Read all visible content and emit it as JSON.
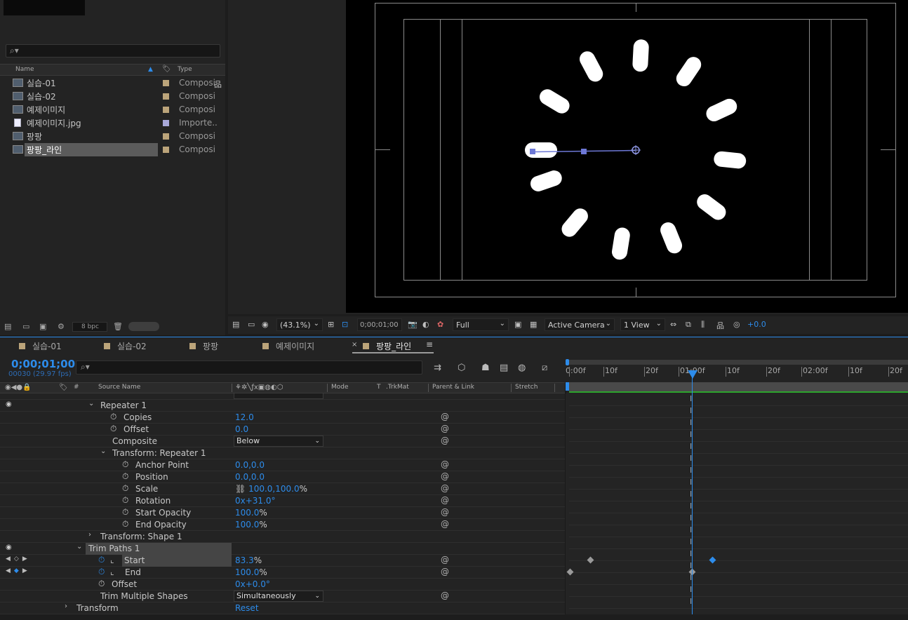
{
  "project": {
    "search_placeholder": "⌕▾",
    "columns": {
      "name": "Name",
      "type": "Type"
    },
    "items": [
      {
        "name": "실습-01",
        "type": "Composi",
        "icon": "composition-icon"
      },
      {
        "name": "실습-02",
        "type": "Composi",
        "icon": "composition-icon"
      },
      {
        "name": "예제이미지",
        "type": "Composi",
        "icon": "composition-icon"
      },
      {
        "name": "예제이미지.jpg",
        "type": "Importe..",
        "icon": "image-file-icon"
      },
      {
        "name": "팡팡",
        "type": "Composi",
        "icon": "composition-icon"
      },
      {
        "name": "팡팡_라인",
        "type": "Composi",
        "icon": "composition-icon",
        "selected": true
      }
    ],
    "bpc": "8 bpc"
  },
  "viewer": {
    "zoom": "(43.1%)",
    "timecode": "0;00;01;00",
    "resolution": "Full",
    "camera": "Active Camera",
    "views": "1 View",
    "exposure": "+0.0",
    "repeater_copies": 12,
    "repeater_rotation_deg": 31
  },
  "timeline": {
    "tabs": [
      "실습-01",
      "실습-02",
      "팡팡",
      "예제이미지",
      "팡팡_라인"
    ],
    "active_tab": "팡팡_라인",
    "current_time": "0;00;01;00",
    "frame_info": "00030 (29.97 fps)",
    "columns": {
      "source_name": "Source Name",
      "mode": "Mode",
      "t": "T",
      "trkmat": ".TrkMat",
      "parent": "Parent & Link",
      "stretch": "Stretch",
      "hash": "#"
    },
    "ruler_ticks": [
      "0:00f",
      "10f",
      "20f",
      "01:00f",
      "10f",
      "20f",
      "02:00f",
      "10f",
      "20f"
    ],
    "rows": {
      "repeater": "Repeater 1",
      "copies_label": "Copies",
      "copies_value": "12.0",
      "offset_label": "Offset",
      "offset_value": "0.0",
      "composite_label": "Composite",
      "composite_value": "Below",
      "transform_repeater": "Transform: Repeater 1",
      "anchor_label": "Anchor Point",
      "anchor_value": "0.0,0.0",
      "position_label": "Position",
      "position_value": "0.0,0.0",
      "scale_label": "Scale",
      "scale_value": "100.0,100.0",
      "scale_unit": "%",
      "rotation_label": "Rotation",
      "rotation_value": "0x+31.0°",
      "start_opacity_label": "Start Opacity",
      "start_opacity_value": "100.0",
      "start_opacity_unit": "%",
      "end_opacity_label": "End Opacity",
      "end_opacity_value": "100.0",
      "end_opacity_unit": "%",
      "transform_shape": "Transform: Shape 1",
      "trim_paths": "Trim Paths 1",
      "start_label": "Start",
      "start_value": "83.3",
      "start_unit": "%",
      "end_label": "End",
      "end_value": "100.0",
      "end_unit": "%",
      "trim_offset_label": "Offset",
      "trim_offset_value": "0x+0.0°",
      "trim_multiple_label": "Trim Multiple Shapes",
      "trim_multiple_value": "Simultaneously",
      "transform_label": "Transform",
      "transform_value": "Reset"
    }
  },
  "colors": {
    "accent": "#2d8ceb",
    "panel": "#232323",
    "comp_bg": "#000000",
    "label_tan": "#bba47a"
  }
}
